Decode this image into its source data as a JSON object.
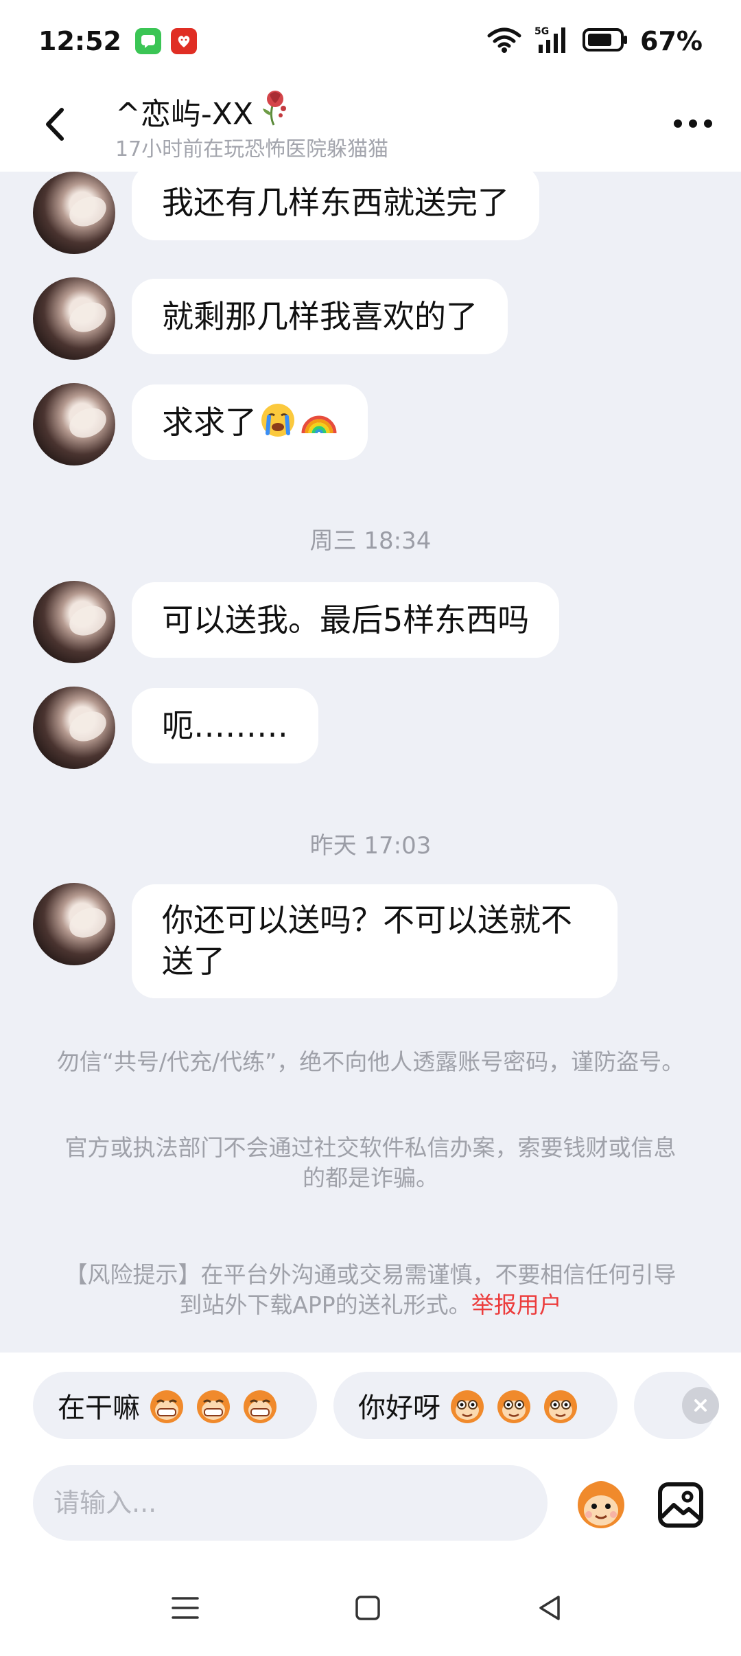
{
  "status_bar": {
    "time": "12:52",
    "network": "5G",
    "battery": "67%",
    "icons": [
      "messages-app-icon",
      "pinduoduo-app-icon",
      "wifi-icon",
      "signal-5g-icon",
      "battery-icon"
    ]
  },
  "header": {
    "title": "^恋屿-XX",
    "title_emoji": "wilted-rose-emoji",
    "subtitle": "17小时前在玩恐怖医院躲猫猫"
  },
  "messages": [
    {
      "text": "我还有几样东西就送完了"
    },
    {
      "text": "就剩那几样我喜欢的了"
    },
    {
      "text": "求求了",
      "emojis": [
        "crying-face-emoji",
        "rainbow-emoji"
      ]
    },
    {
      "text": "可以送我。最后5样东西吗"
    },
    {
      "text": "呃………"
    },
    {
      "text": "你还可以送吗？不可以送就不送了"
    }
  ],
  "timestamps": [
    "周三 18:34",
    "昨天 17:03"
  ],
  "notices": {
    "warning_1": "勿信“共号/代充/代练”，绝不向他人透露账号密码，谨防盗号。",
    "warning_2": "官方或执法部门不会通过社交软件私信办案，索要钱财或信息的都是诈骗。",
    "risk_tip": "【风险提示】在平台外沟通或交易需谨慎，不要相信任何引导到站外下载APP的送礼形式。",
    "report_link": "举报用户"
  },
  "quick_replies": [
    {
      "label": "在干嘛",
      "emoji": "grinning-monkey-emoji"
    },
    {
      "label": "你好呀",
      "emoji": "smiling-monkey-emoji"
    }
  ],
  "input": {
    "placeholder": "请输入..."
  },
  "colors": {
    "chat_bg": "#eef0f6",
    "bubble": "#ffffff",
    "muted_text": "#9fa1a9",
    "report_red": "#ec3c3c"
  }
}
